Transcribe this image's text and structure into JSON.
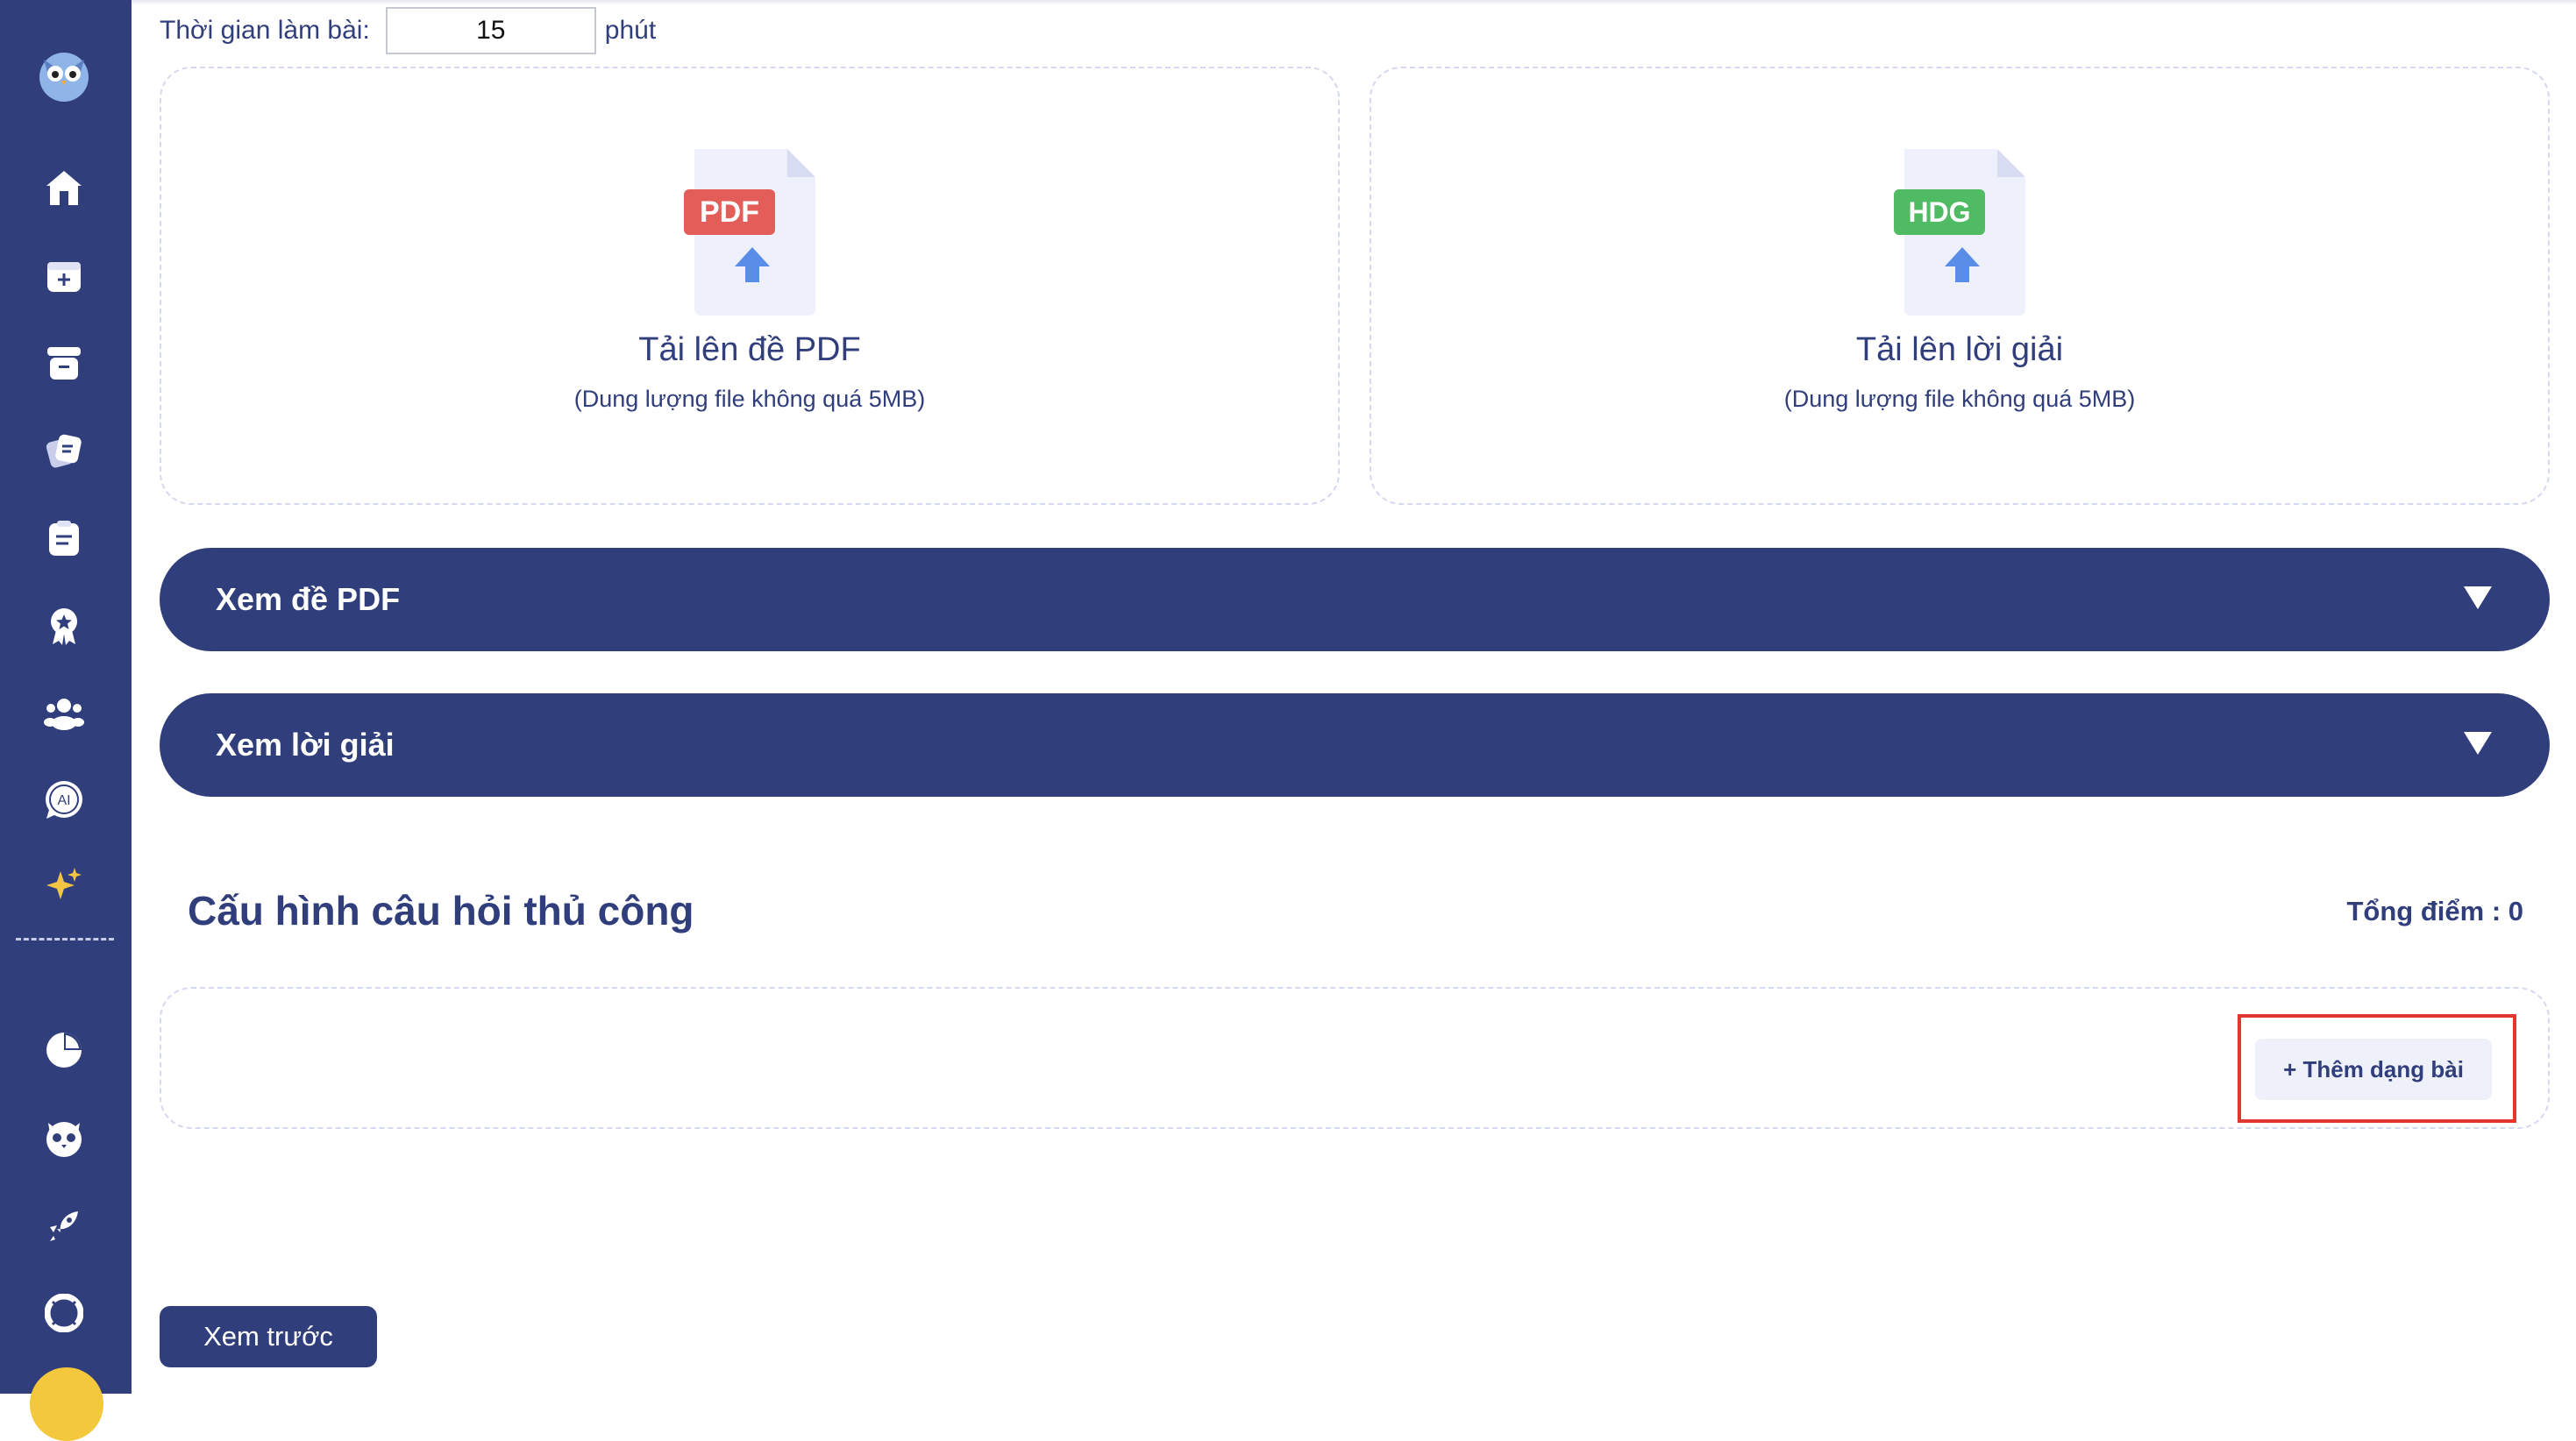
{
  "time": {
    "label": "Thời gian làm bài:",
    "value": "15",
    "unit": "phút"
  },
  "uploads": {
    "pdf": {
      "badge": "PDF",
      "badge_color": "#e35d59",
      "title": "Tải lên đề PDF",
      "note": "(Dung lượng file không quá 5MB)"
    },
    "solution": {
      "badge": "HDG",
      "badge_color": "#4fbb63",
      "title": "Tải lên lời giải",
      "note": "(Dung lượng file không quá 5MB)"
    }
  },
  "accordions": {
    "view_pdf": "Xem đề PDF",
    "view_solution": "Xem lời giải"
  },
  "manual": {
    "title": "Cấu hình câu hỏi thủ công",
    "total": "Tổng điểm : 0",
    "add_label": "+ Thêm dạng bài"
  },
  "preview_label": "Xem trước",
  "sidebar_icons": [
    "owl-logo-icon",
    "home-icon",
    "calendar-add-icon",
    "archive-box-icon",
    "cards-icon",
    "clipboard-icon",
    "award-icon",
    "users-icon",
    "ai-chat-icon",
    "sparkle-icon",
    "pie-chart-icon",
    "owl-face-icon",
    "rocket-icon",
    "lifebuoy-icon"
  ],
  "colors": {
    "primary": "#313e7c",
    "highlight": "#e2362f"
  }
}
